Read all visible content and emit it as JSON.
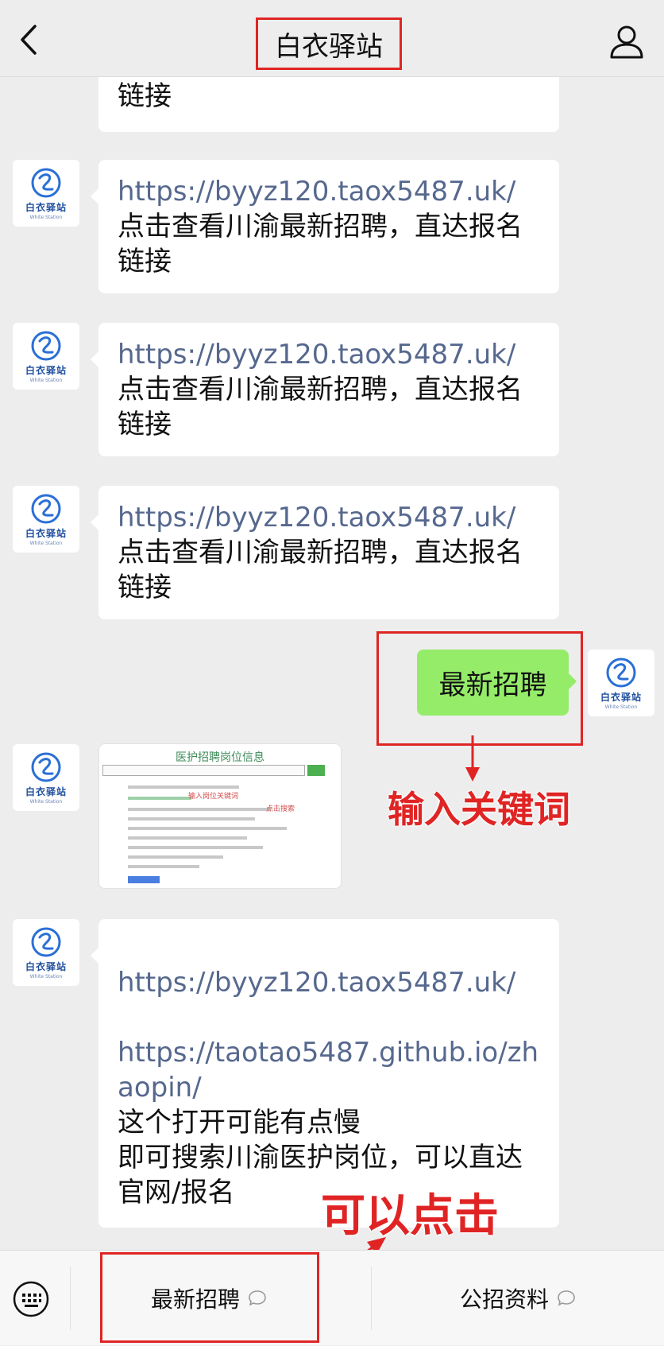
{
  "header": {
    "title": "白衣驿站"
  },
  "avatar": {
    "name": "白衣驿站",
    "subtitle": "White Station"
  },
  "messages": {
    "top_partial": {
      "text": "链接"
    },
    "link_msgs": [
      {
        "link": "https://byyz120.taox5487.uk/",
        "line1": "点击查看川渝最新招聘，直达报名",
        "line2": "链接"
      },
      {
        "link": "https://byyz120.taox5487.uk/",
        "line1": "点击查看川渝最新招聘，直达报名",
        "line2": "链接"
      },
      {
        "link": "https://byyz120.taox5487.uk/",
        "line1": "点击查看川渝最新招聘，直达报名",
        "line2": "链接"
      }
    ],
    "user_msg": "最新招聘",
    "image_msg": {
      "title": "医护招聘岗位信息",
      "note1": "输入岗位关键词",
      "note2": "点击搜索"
    },
    "last_msg": {
      "link1": "https://byyz120.taox5487.uk/",
      "link2": "https://taotao5487.github.io/zhaopin/",
      "line1": "这个打开可能有点慢",
      "line2": "即可搜索川渝医护岗位，可以直达",
      "line3": "官网/报名"
    }
  },
  "annotations": {
    "keyword": "输入关键词",
    "clickable": "可以点击"
  },
  "menu": {
    "item1": "最新招聘",
    "item2": "公招资料"
  },
  "colors": {
    "accent_red": "#e02424",
    "link": "#56688e",
    "green_bubble": "#95ec69"
  }
}
